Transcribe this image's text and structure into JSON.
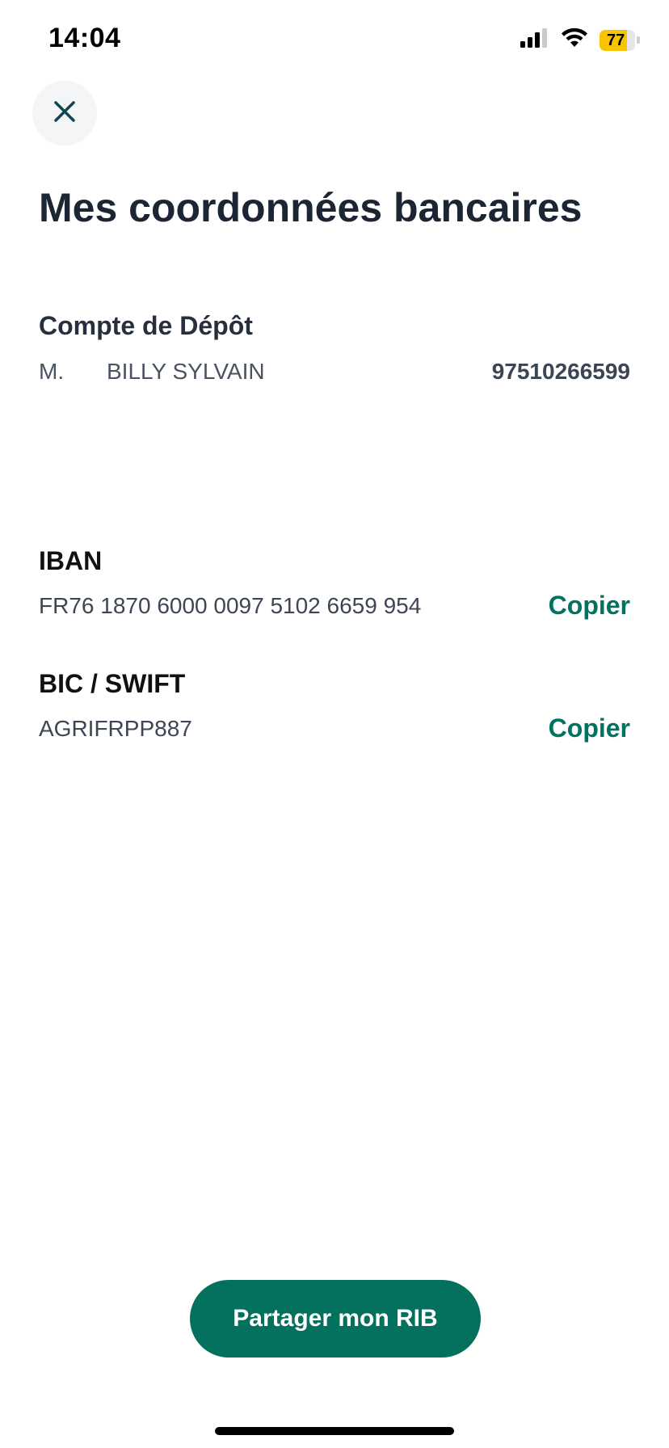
{
  "status_bar": {
    "time": "14:04",
    "battery_level": "77",
    "battery_color": "#f7c500",
    "icons": [
      "signal-icon",
      "wifi-icon",
      "battery-icon"
    ]
  },
  "header": {
    "close_icon": "close-icon",
    "title": "Mes coordonnées bancaires"
  },
  "account": {
    "name": "Compte de Dépôt",
    "holder_civility": "M.",
    "holder_name": "BILLY SYLVAIN",
    "number": "97510266599"
  },
  "iban": {
    "label": "IBAN",
    "value": "FR76 1870 6000 0097 5102 6659 954",
    "copy_label": "Copier"
  },
  "bic": {
    "label": "BIC / SWIFT",
    "value": "AGRIFRPP887",
    "copy_label": "Copier"
  },
  "actions": {
    "share_label": "Partager mon RIB"
  },
  "colors": {
    "accent": "#04705e",
    "link": "#007361",
    "title": "#1b2533"
  }
}
